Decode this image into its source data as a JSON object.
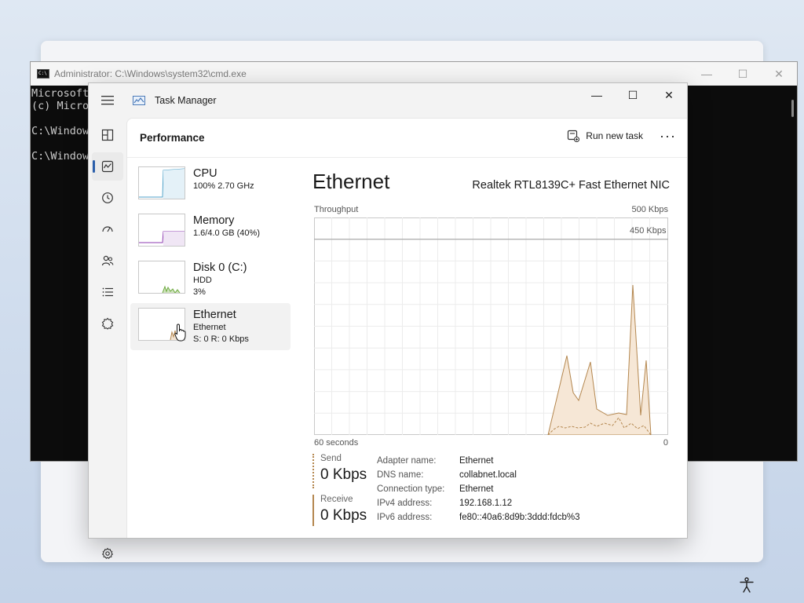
{
  "cmd": {
    "title": "Administrator: C:\\Windows\\system32\\cmd.exe",
    "lines": [
      "Microsoft",
      "(c) Micro",
      "",
      "C:\\Window",
      "",
      "C:\\Window"
    ],
    "controls": {
      "minimize": "—",
      "maximize": "☐",
      "close": "✕"
    }
  },
  "tm": {
    "title": "Task Manager",
    "controls": {
      "minimize": "—",
      "maximize": "☐",
      "close": "✕"
    },
    "page_title": "Performance",
    "run_new_task": "Run new task",
    "more": "···",
    "nav_icons": [
      "processes-icon",
      "performance-icon",
      "app-history-icon",
      "startup-apps-icon",
      "users-icon",
      "details-icon",
      "services-icon",
      "settings-icon"
    ],
    "perf_items": [
      {
        "name": "CPU",
        "sub1": "100%  2.70 GHz",
        "sub2": ""
      },
      {
        "name": "Memory",
        "sub1": "1.6/4.0 GB (40%)",
        "sub2": ""
      },
      {
        "name": "Disk 0 (C:)",
        "sub1": "HDD",
        "sub2": "3%"
      },
      {
        "name": "Ethernet",
        "sub1": "Ethernet",
        "sub2": "S: 0  R: 0 Kbps"
      }
    ],
    "detail": {
      "title": "Ethernet",
      "adapter": "Realtek RTL8139C+ Fast Ethernet NIC",
      "throughput_label": "Throughput",
      "max_label": "500 Kbps",
      "line_label": "450 Kbps",
      "time_label": "60 seconds",
      "zero_label": "0",
      "send_label": "Send",
      "send_value": "0 Kbps",
      "receive_label": "Receive",
      "receive_value": "0 Kbps",
      "properties": [
        {
          "key": "Adapter name:",
          "value": "Ethernet"
        },
        {
          "key": "DNS name:",
          "value": "collabnet.local"
        },
        {
          "key": "Connection type:",
          "value": "Ethernet"
        },
        {
          "key": "IPv4 address:",
          "value": "192.168.1.12"
        },
        {
          "key": "IPv6 address:",
          "value": "fe80::40a6:8d9b:3ddd:fdcb%3"
        }
      ]
    },
    "colors": {
      "accent": "#2b5fab",
      "ethernet": "#b4874f",
      "cpu": "#4fa2c9",
      "memory": "#8e3bb0",
      "disk": "#6aa83b"
    }
  }
}
